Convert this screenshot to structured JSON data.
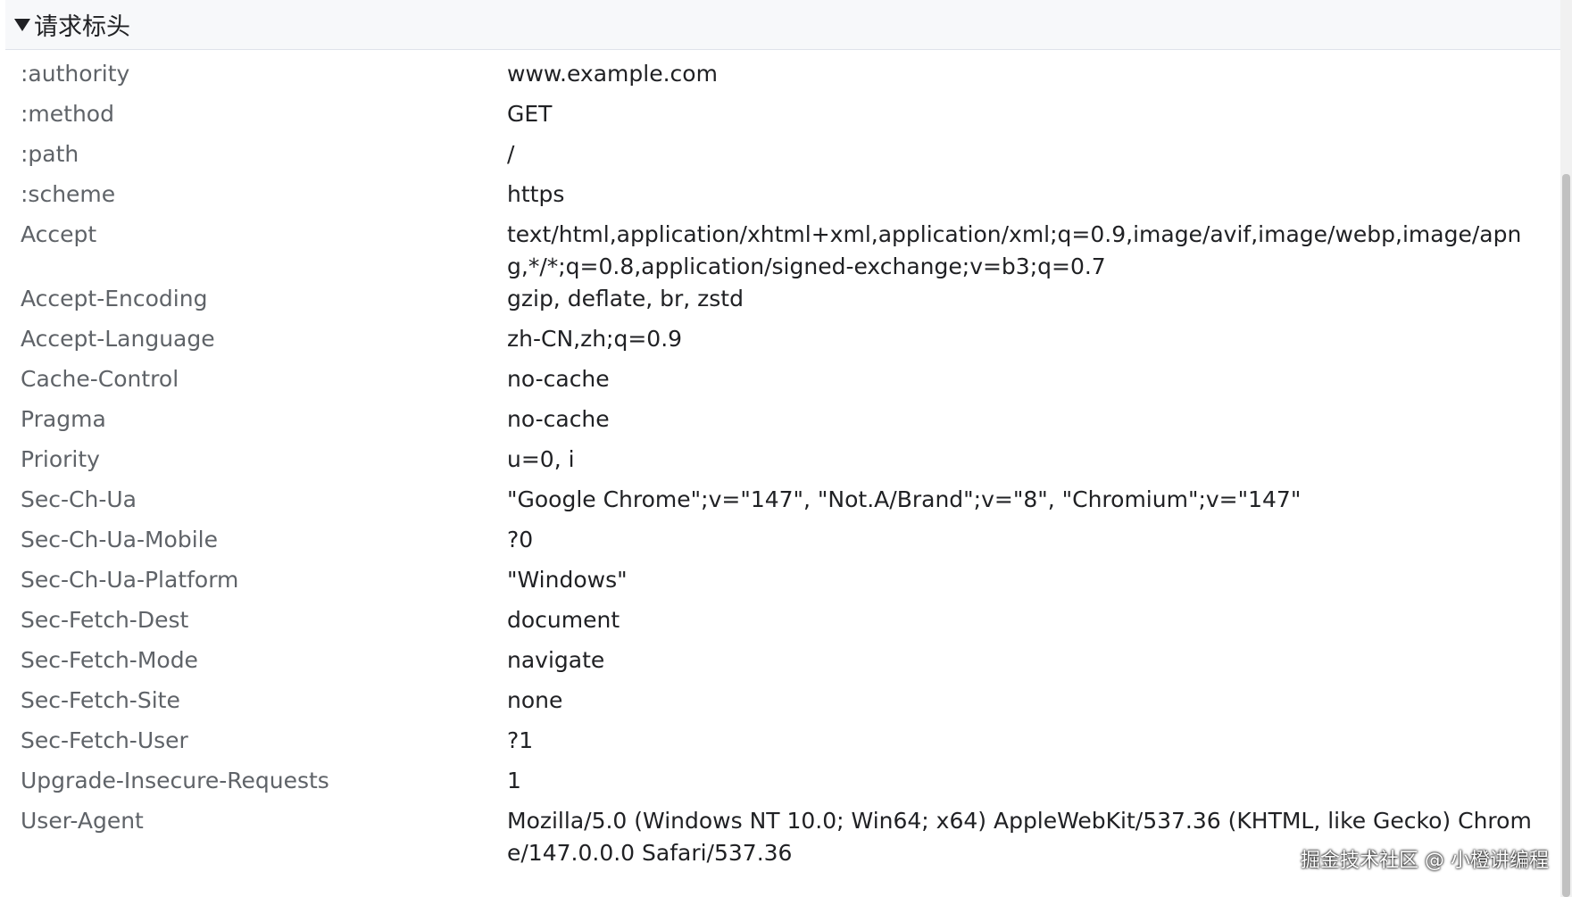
{
  "section": {
    "title": "请求标头"
  },
  "headers": [
    {
      "name": ":authority",
      "value": "www.example.com"
    },
    {
      "name": ":method",
      "value": "GET"
    },
    {
      "name": ":path",
      "value": "/"
    },
    {
      "name": ":scheme",
      "value": "https"
    },
    {
      "name": "Accept",
      "value": "text/html,application/xhtml+xml,application/xml;q=0.9,image/avif,image/webp,image/apng,*/*;q=0.8,application/signed-exchange;v=b3;q=0.7"
    },
    {
      "name": "Accept-Encoding",
      "value": "gzip, deflate, br, zstd"
    },
    {
      "name": "Accept-Language",
      "value": "zh-CN,zh;q=0.9"
    },
    {
      "name": "Cache-Control",
      "value": "no-cache"
    },
    {
      "name": "Pragma",
      "value": "no-cache"
    },
    {
      "name": "Priority",
      "value": "u=0, i"
    },
    {
      "name": "Sec-Ch-Ua",
      "value": "\"Google Chrome\";v=\"147\", \"Not.A/Brand\";v=\"8\", \"Chromium\";v=\"147\""
    },
    {
      "name": "Sec-Ch-Ua-Mobile",
      "value": "?0"
    },
    {
      "name": "Sec-Ch-Ua-Platform",
      "value": "\"Windows\""
    },
    {
      "name": "Sec-Fetch-Dest",
      "value": "document"
    },
    {
      "name": "Sec-Fetch-Mode",
      "value": "navigate"
    },
    {
      "name": "Sec-Fetch-Site",
      "value": "none"
    },
    {
      "name": "Sec-Fetch-User",
      "value": "?1"
    },
    {
      "name": "Upgrade-Insecure-Requests",
      "value": "1"
    },
    {
      "name": "User-Agent",
      "value": "Mozilla/5.0 (Windows NT 10.0; Win64; x64) AppleWebKit/537.36 (KHTML, like Gecko) Chrome/147.0.0.0 Safari/537.36"
    }
  ],
  "watermark": "掘金技术社区 @ 小橙讲编程"
}
